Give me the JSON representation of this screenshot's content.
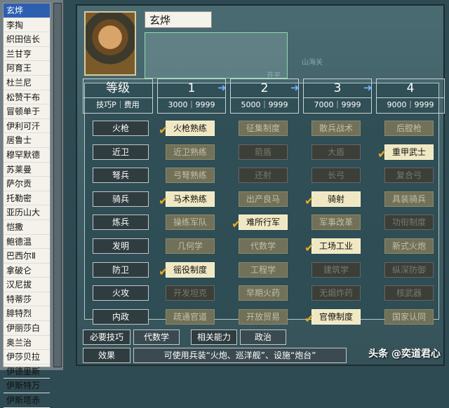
{
  "sidebar": {
    "items": [
      "玄烨",
      "李掏",
      "织田信长",
      "兰甘亨",
      "阿育王",
      "杜兰尼",
      "松赞干布",
      "冒顿单于",
      "伊利可汗",
      "居鲁士",
      "穆罕默德",
      "苏莱曼",
      "萨尔贡",
      "托勒密",
      "亚历山大",
      "恺撒",
      "鲍德温",
      "巴西尔Ⅱ",
      "拿破仑",
      "汉尼拔",
      "特蒂莎",
      "腓特烈",
      "伊丽莎白",
      "奥兰治",
      "伊莎贝拉",
      "伊德里斯",
      "伊斯特万",
      "伊斯塔赤"
    ]
  },
  "ruler": {
    "name": "玄烨"
  },
  "map_labels": [
    "山海关",
    "开平"
  ],
  "header": {
    "title": "等级",
    "subtitle": "技巧P｜费用",
    "levels": [
      {
        "num": "1",
        "cost": "3000｜9999"
      },
      {
        "num": "2",
        "cost": "5000｜9999"
      },
      {
        "num": "3",
        "cost": "7000｜9999"
      },
      {
        "num": "4",
        "cost": "9000｜9999"
      }
    ]
  },
  "rows": [
    {
      "cat": "火枪",
      "techs": [
        {
          "name": "火枪熟练",
          "state": "on",
          "check": true
        },
        {
          "name": "征集制度",
          "state": "normal"
        },
        {
          "name": "散兵战术",
          "state": "normal"
        },
        {
          "name": "后膛枪",
          "state": "normal"
        }
      ]
    },
    {
      "cat": "近卫",
      "techs": [
        {
          "name": "近卫熟练",
          "state": "normal"
        },
        {
          "name": "箭盾",
          "state": "dark"
        },
        {
          "name": "大盾",
          "state": "dark"
        },
        {
          "name": "重甲武士",
          "state": "on",
          "check": true
        }
      ]
    },
    {
      "cat": "弩兵",
      "techs": [
        {
          "name": "弓弩熟练",
          "state": "normal"
        },
        {
          "name": "还射",
          "state": "dark"
        },
        {
          "name": "长弓",
          "state": "dark"
        },
        {
          "name": "复合弓",
          "state": "dark"
        }
      ]
    },
    {
      "cat": "骑兵",
      "techs": [
        {
          "name": "马术熟练",
          "state": "on",
          "check": true
        },
        {
          "name": "出产良马",
          "state": "normal"
        },
        {
          "name": "骑射",
          "state": "on",
          "check": true
        },
        {
          "name": "具装骑兵",
          "state": "normal"
        }
      ]
    },
    {
      "cat": "炼兵",
      "techs": [
        {
          "name": "操练军队",
          "state": "normal"
        },
        {
          "name": "难所行军",
          "state": "on",
          "check": true
        },
        {
          "name": "军事改革",
          "state": "normal"
        },
        {
          "name": "功衔制度",
          "state": "dark"
        }
      ]
    },
    {
      "cat": "发明",
      "techs": [
        {
          "name": "几何学",
          "state": "normal"
        },
        {
          "name": "代数学",
          "state": "normal"
        },
        {
          "name": "工场工业",
          "state": "on",
          "check": true
        },
        {
          "name": "新式火炮",
          "state": "normal"
        }
      ]
    },
    {
      "cat": "防卫",
      "techs": [
        {
          "name": "徭役制度",
          "state": "on",
          "check": true
        },
        {
          "name": "工程学",
          "state": "normal"
        },
        {
          "name": "建筑学",
          "state": "dark"
        },
        {
          "name": "纵深防御",
          "state": "dark"
        }
      ]
    },
    {
      "cat": "火攻",
      "techs": [
        {
          "name": "开发坦克",
          "state": "dark"
        },
        {
          "name": "早期火药",
          "state": "normal"
        },
        {
          "name": "无烟炸药",
          "state": "dark"
        },
        {
          "name": "核武器",
          "state": "dark"
        }
      ]
    },
    {
      "cat": "内政",
      "techs": [
        {
          "name": "疏通官道",
          "state": "normal"
        },
        {
          "name": "开放贸易",
          "state": "normal"
        },
        {
          "name": "官僚制度",
          "state": "on",
          "check": true
        },
        {
          "name": "国家认同",
          "state": "normal"
        }
      ]
    }
  ],
  "footer": {
    "req_label": "必要技巧",
    "req_val": "代数学",
    "rel_label": "相关能力",
    "rel_val": "政治",
    "effect_label": "效果",
    "effect_val": "可使用兵装“火炮、巡洋舰”、设施“炮台”"
  },
  "watermark": "头条 @奕道君心"
}
